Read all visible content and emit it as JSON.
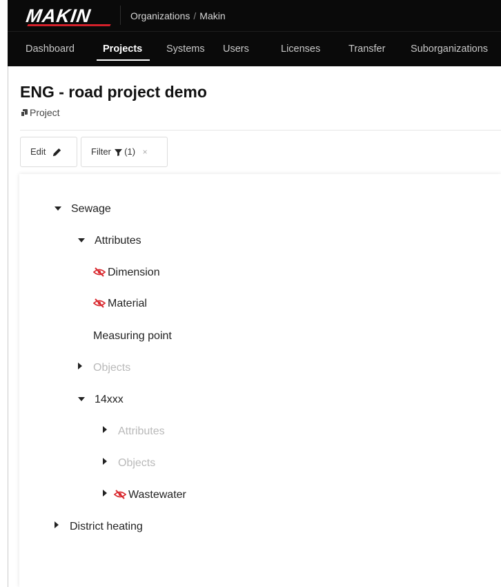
{
  "brand": {
    "logo_text": "MAKIN",
    "accent": "#d4202a"
  },
  "breadcrumb": {
    "items": [
      "Organizations",
      "Makin"
    ],
    "separator": "/"
  },
  "nav": {
    "items": [
      {
        "label": "Dashboard",
        "active": false
      },
      {
        "label": "Projects",
        "active": true
      },
      {
        "label": "Systems",
        "active": false
      },
      {
        "label": "Users",
        "active": false
      },
      {
        "label": "Licenses",
        "active": false
      },
      {
        "label": "Transfer",
        "active": false
      },
      {
        "label": "Suborganizations",
        "active": false
      }
    ]
  },
  "page": {
    "title": "ENG - road project demo",
    "subtitle": "Project"
  },
  "toolbar": {
    "edit_label": "Edit",
    "filter_label": "Filter",
    "filter_count": "(1)",
    "clear_label": "×"
  },
  "tree": {
    "nodes": [
      {
        "label": "Sewage",
        "state": "expanded"
      },
      {
        "label": "Attributes",
        "state": "expanded"
      },
      {
        "label": "Dimension",
        "state": "leaf",
        "hidden": true
      },
      {
        "label": "Material",
        "state": "leaf",
        "hidden": true
      },
      {
        "label": "Measuring point",
        "state": "leaf",
        "hidden": false
      },
      {
        "label": "Objects",
        "state": "collapsed",
        "muted": true
      },
      {
        "label": "14xxx",
        "state": "expanded"
      },
      {
        "label": "Attributes",
        "state": "collapsed",
        "muted": true
      },
      {
        "label": "Objects",
        "state": "collapsed",
        "muted": true
      },
      {
        "label": "Wastewater",
        "state": "collapsed",
        "hidden": true
      },
      {
        "label": "District heating",
        "state": "collapsed"
      }
    ]
  },
  "icons": {
    "edit": "pencil-icon",
    "filter": "funnel-icon",
    "hidden": "eye-slash-icon",
    "project": "project-icon"
  },
  "colors": {
    "hidden_icon": "#d9292f",
    "muted_text": "#b9b9b9"
  }
}
